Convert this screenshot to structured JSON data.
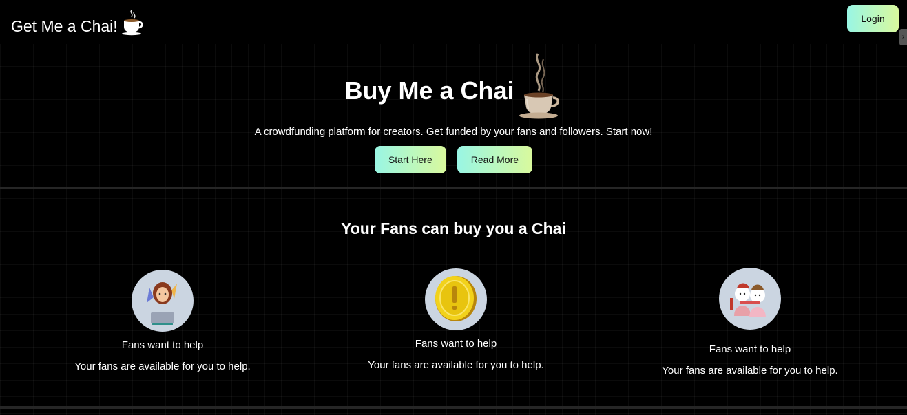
{
  "navbar": {
    "brand": "Get Me a Chai!",
    "brand_icon": "coffee-cup-icon",
    "login_label": "Login"
  },
  "hero": {
    "title": "Buy Me a Chai",
    "title_icon": "steaming-tea-cup-icon",
    "tagline": "A crowdfunding platform for creators. Get funded by your fans and followers. Start now!",
    "start_label": "Start Here",
    "read_more_label": "Read More"
  },
  "features": {
    "heading": "Your Fans can buy you a Chai",
    "items": [
      {
        "icon": "creator-woman-illustration",
        "title": "Fans want to help",
        "description": "Your fans are available for you to help."
      },
      {
        "icon": "gold-coin-illustration",
        "title": "Fans want to help",
        "description": "Your fans are available for you to help."
      },
      {
        "icon": "group-of-friends-illustration",
        "title": "Fans want to help",
        "description": "Your fans are available for you to help."
      }
    ]
  },
  "colors": {
    "background": "#000000",
    "button_gradient_start": "#99f6e4",
    "button_gradient_end": "#d9f99d",
    "divider": "#262626"
  }
}
